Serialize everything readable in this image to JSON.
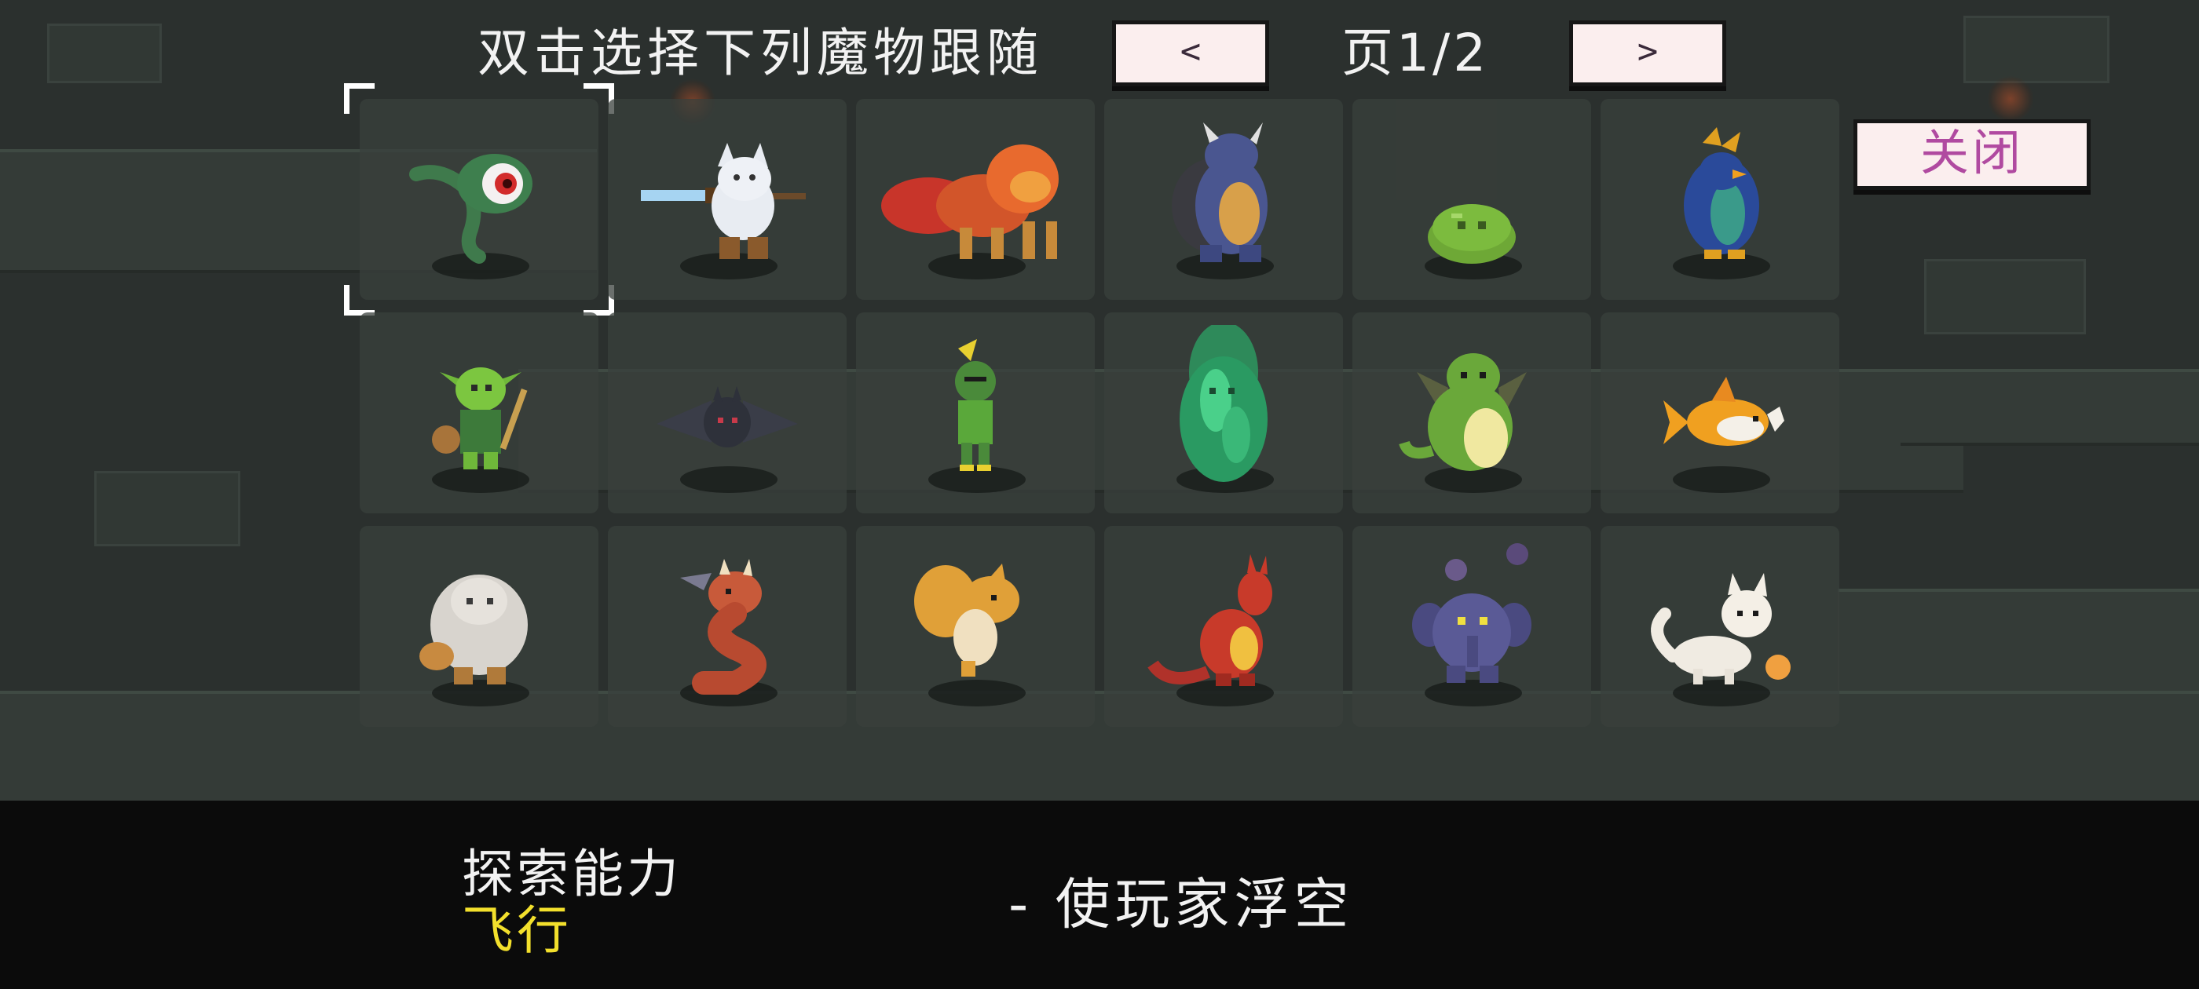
{
  "header": {
    "title": "双击选择下列魔物跟随",
    "prev_label": "<",
    "next_label": ">",
    "page_indicator": "页1/2"
  },
  "close_label": "关闭",
  "selected_index": 0,
  "monsters": [
    {
      "name": "green-eyeball-tadpole"
    },
    {
      "name": "white-cat-swordsman"
    },
    {
      "name": "fire-lion"
    },
    {
      "name": "blue-turtle-dragon"
    },
    {
      "name": "green-slime"
    },
    {
      "name": "blue-penguin-mage"
    },
    {
      "name": "goblin-warrior"
    },
    {
      "name": "dark-bat"
    },
    {
      "name": "green-knight"
    },
    {
      "name": "green-spirit-tree"
    },
    {
      "name": "green-dragon"
    },
    {
      "name": "goldfish"
    },
    {
      "name": "white-yeti"
    },
    {
      "name": "red-horned-serpent"
    },
    {
      "name": "orange-squirrel"
    },
    {
      "name": "red-kangaroo"
    },
    {
      "name": "purple-elephant"
    },
    {
      "name": "white-cat"
    }
  ],
  "info": {
    "ability_label": "探索能力",
    "ability_name": "飞行",
    "ability_desc": "- 使玩家浮空"
  },
  "colors": {
    "accent_yellow": "#f3e02c",
    "button_bg": "#fbeeee",
    "close_text": "#b04aa0",
    "background": "#2b302e"
  }
}
